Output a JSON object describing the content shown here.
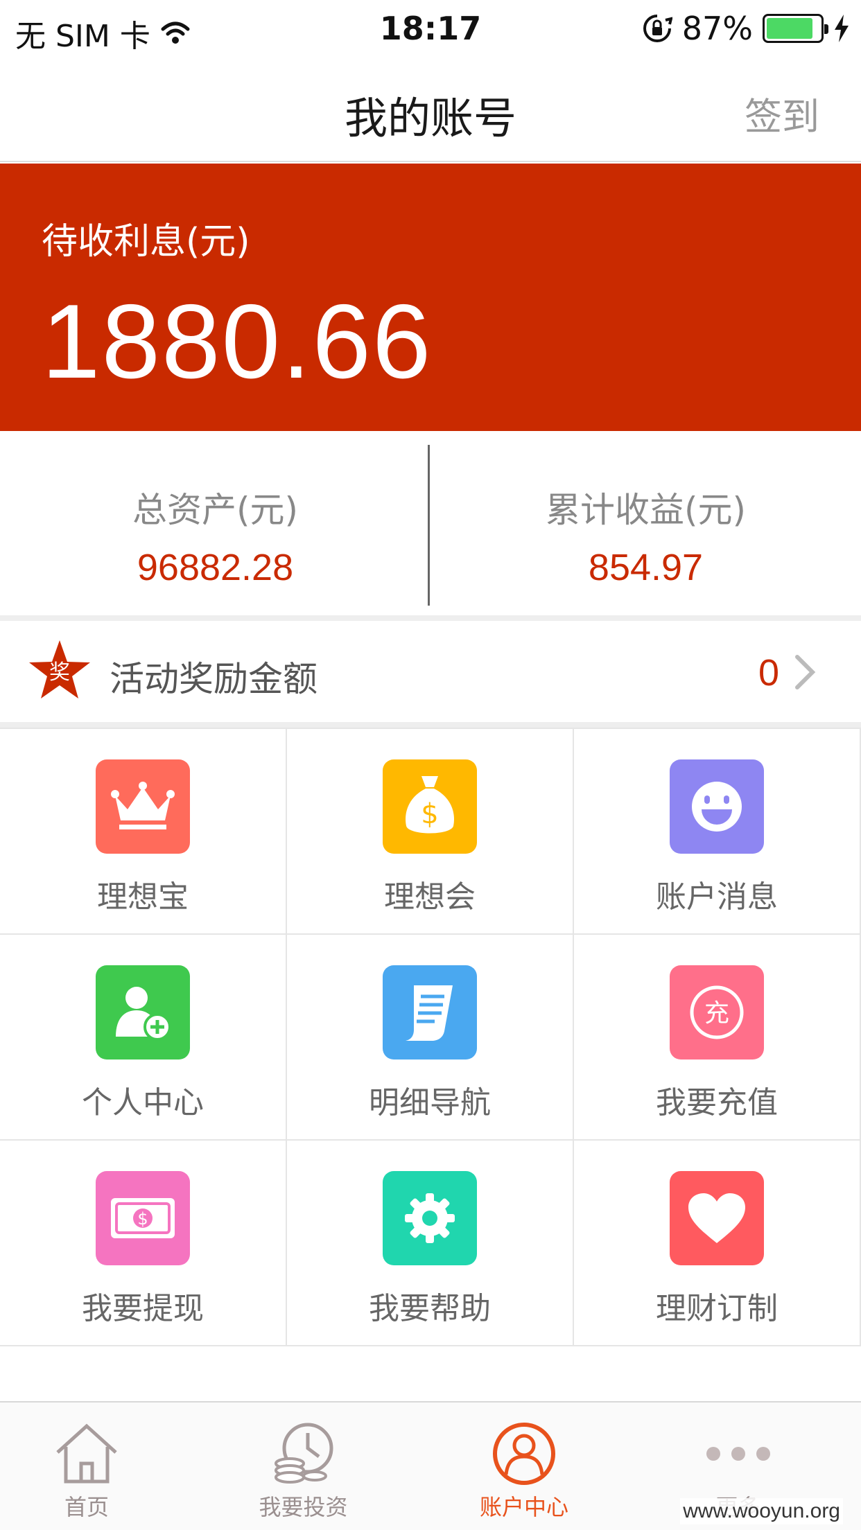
{
  "status_bar": {
    "carrier": "无 SIM 卡",
    "time": "18:17",
    "battery_percent": "87%",
    "battery_level": 0.87
  },
  "nav": {
    "title": "我的账号",
    "action": "签到"
  },
  "hero": {
    "label": "待收利息(元)",
    "value": "1880.66",
    "background": "#c92a00"
  },
  "summary": {
    "total_assets_label": "总资产(元)",
    "total_assets_value": "96882.28",
    "income_label": "累计收益(元)",
    "income_value": "854.97"
  },
  "reward": {
    "badge": "奖",
    "label": "活动奖励金额",
    "count": "0"
  },
  "grid": [
    {
      "label": "理想宝",
      "icon": "crown-icon",
      "color": "#ff6b5b"
    },
    {
      "label": "理想会",
      "icon": "money-bag-icon",
      "color": "#ffb800"
    },
    {
      "label": "账户消息",
      "icon": "smiley-icon",
      "color": "#8e86f2"
    },
    {
      "label": "个人中心",
      "icon": "add-user-icon",
      "color": "#3fc94e"
    },
    {
      "label": "明细导航",
      "icon": "receipt-icon",
      "color": "#4aa8f0"
    },
    {
      "label": "我要充值",
      "icon": "recharge-icon",
      "color": "#ff6f8a"
    },
    {
      "label": "我要提现",
      "icon": "banknote-icon",
      "color": "#f574c0"
    },
    {
      "label": "我要帮助",
      "icon": "gear-icon",
      "color": "#20d6ae"
    },
    {
      "label": "理财订制",
      "icon": "heart-icon",
      "color": "#ff5a5f"
    }
  ],
  "tabs": [
    {
      "label": "首页",
      "icon": "home-icon"
    },
    {
      "label": "我要投资",
      "icon": "invest-icon"
    },
    {
      "label": "账户中心",
      "icon": "account-icon",
      "active": true
    },
    {
      "label": "更多",
      "icon": "more-icon"
    }
  ],
  "watermark": "www.wooyun.org"
}
